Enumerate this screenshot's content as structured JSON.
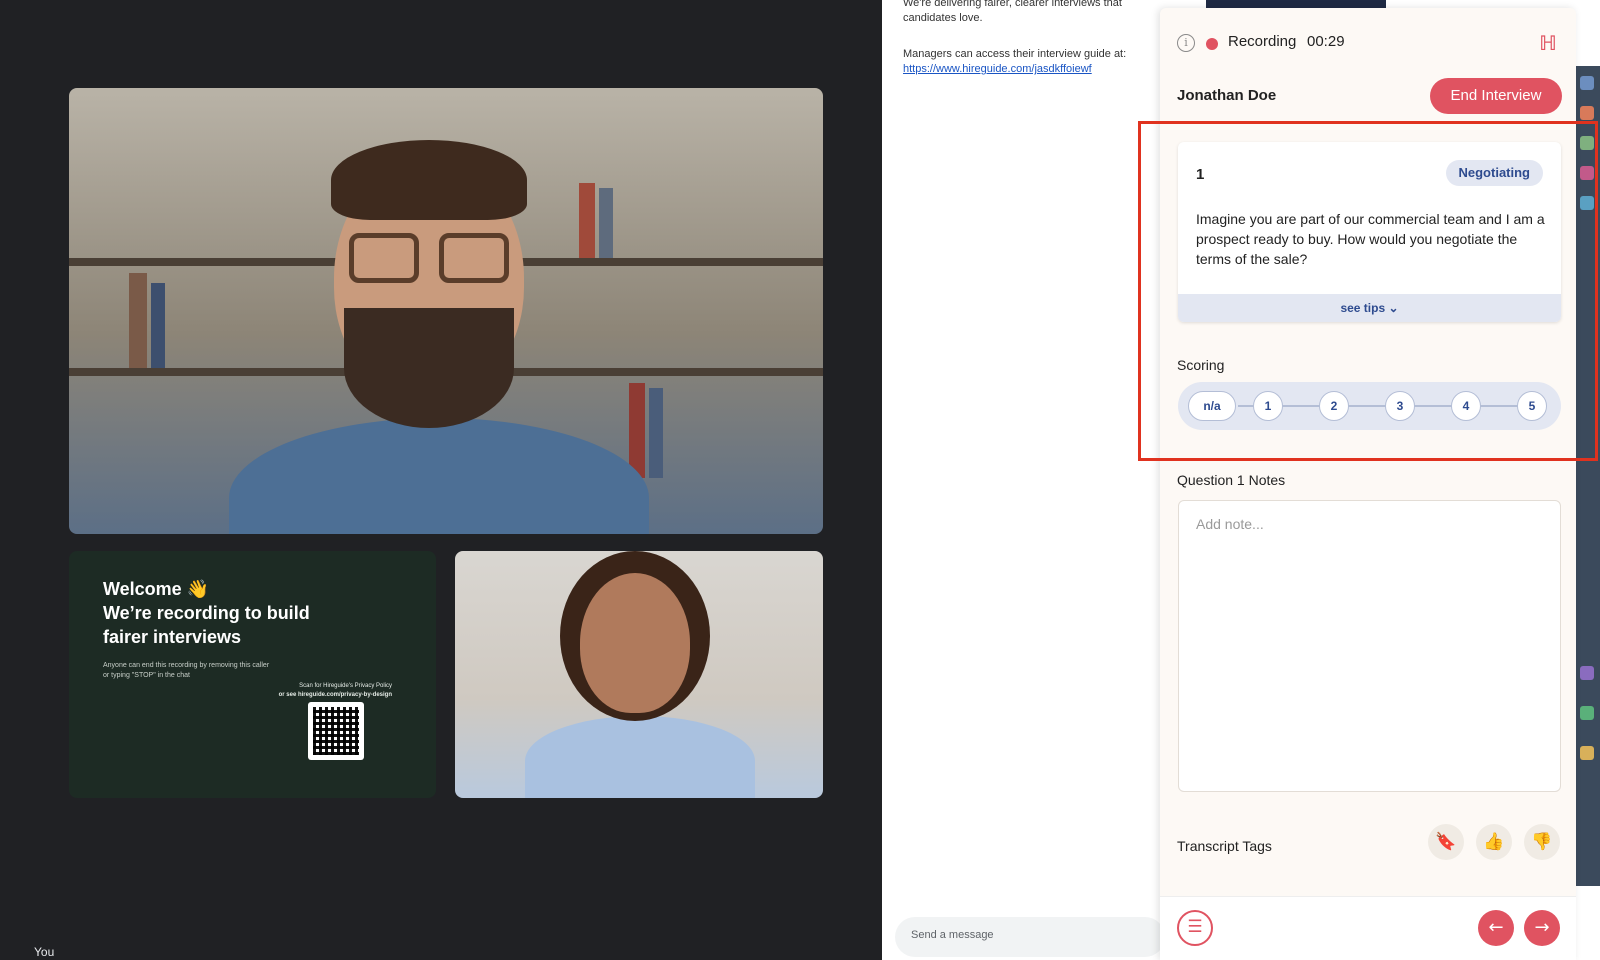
{
  "video": {
    "welcome": {
      "line1": "Welcome 👋",
      "line2": "We’re recording to build",
      "line3": "fairer interviews",
      "note": "Anyone can end this recording by removing this caller or typing \"STOP\" in the chat",
      "scan_note": "Scan for Hireguide's Privacy Policy",
      "scan_url": "or see hireguide.com/privacy-by-design"
    },
    "self_label": "You"
  },
  "chat": {
    "message1": "We're delivering fairer, clearer interviews that candidates love.",
    "message2": "Managers can access their interview guide at:",
    "link": "https://www.hireguide.com/jasdkffoiewf",
    "send_placeholder": "Send a message"
  },
  "panel": {
    "info_icon": "info-icon",
    "recording_label": "Recording",
    "recording_time": "00:29",
    "logo_glyph": "ℍ",
    "candidate_name": "Jonathan Doe",
    "end_button": "End Interview",
    "question": {
      "number": "1",
      "tag": "Negotiating",
      "text": "Imagine you are part of our commercial team and I am a prospect ready to buy. How would you negotiate the terms of the sale?",
      "tips": "see tips ⌄"
    },
    "scoring": {
      "label": "Scoring",
      "options": [
        "n/a",
        "1",
        "2",
        "3",
        "4",
        "5"
      ]
    },
    "notes": {
      "label": "Question 1 Notes",
      "placeholder": "Add note..."
    },
    "transcript_tags": {
      "label": "Transcript Tags",
      "bookmark": "🔖",
      "thumbs_up": "👍",
      "thumbs_down": "👎"
    },
    "footer": {
      "list_glyph": "☰",
      "prev_glyph": "←",
      "next_glyph": "→"
    }
  },
  "colors": {
    "accent": "#e05361",
    "tag_bg": "#e3e7f2",
    "tag_text": "#2e4b8f",
    "highlight": "#e0321f"
  }
}
